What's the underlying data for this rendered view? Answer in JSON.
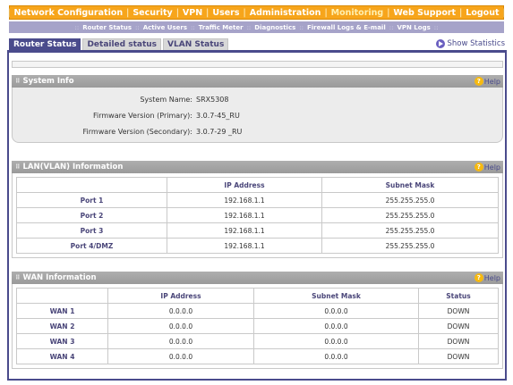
{
  "topnav": {
    "items": [
      "Network Configuration",
      "Security",
      "VPN",
      "Users",
      "Administration",
      "Monitoring",
      "Web Support",
      "Logout"
    ],
    "active_index": 5
  },
  "subnav": {
    "items": [
      "Router Status",
      "Active Users",
      "Traffic Meter",
      "Diagnostics",
      "Firewall Logs & E-mail",
      "VPN Logs"
    ],
    "active_index": 0
  },
  "tabs": [
    "Router Status",
    "Detailed status",
    "VLAN Status"
  ],
  "show_statistics": "Show Statistics",
  "help_label": "Help",
  "system_info": {
    "title": "System Info",
    "rows": [
      {
        "label": "System Name:",
        "value": "SRX5308"
      },
      {
        "label": "Firmware Version (Primary):",
        "value": "3.0.7-45_RU"
      },
      {
        "label": "Firmware Version (Secondary):",
        "value": "3.0.7-29 _RU"
      }
    ]
  },
  "lan": {
    "title": "LAN(VLAN) Information",
    "headers": [
      "",
      "IP Address",
      "Subnet Mask"
    ],
    "rows": [
      [
        "Port 1",
        "192.168.1.1",
        "255.255.255.0"
      ],
      [
        "Port 2",
        "192.168.1.1",
        "255.255.255.0"
      ],
      [
        "Port 3",
        "192.168.1.1",
        "255.255.255.0"
      ],
      [
        "Port 4/DMZ",
        "192.168.1.1",
        "255.255.255.0"
      ]
    ]
  },
  "wan": {
    "title": "WAN Information",
    "headers": [
      "",
      "IP Address",
      "Subnet Mask",
      "Status"
    ],
    "rows": [
      [
        "WAN 1",
        "0.0.0.0",
        "0.0.0.0",
        "DOWN"
      ],
      [
        "WAN 2",
        "0.0.0.0",
        "0.0.0.0",
        "DOWN"
      ],
      [
        "WAN 3",
        "0.0.0.0",
        "0.0.0.0",
        "DOWN"
      ],
      [
        "WAN 4",
        "0.0.0.0",
        "0.0.0.0",
        "DOWN"
      ]
    ]
  }
}
